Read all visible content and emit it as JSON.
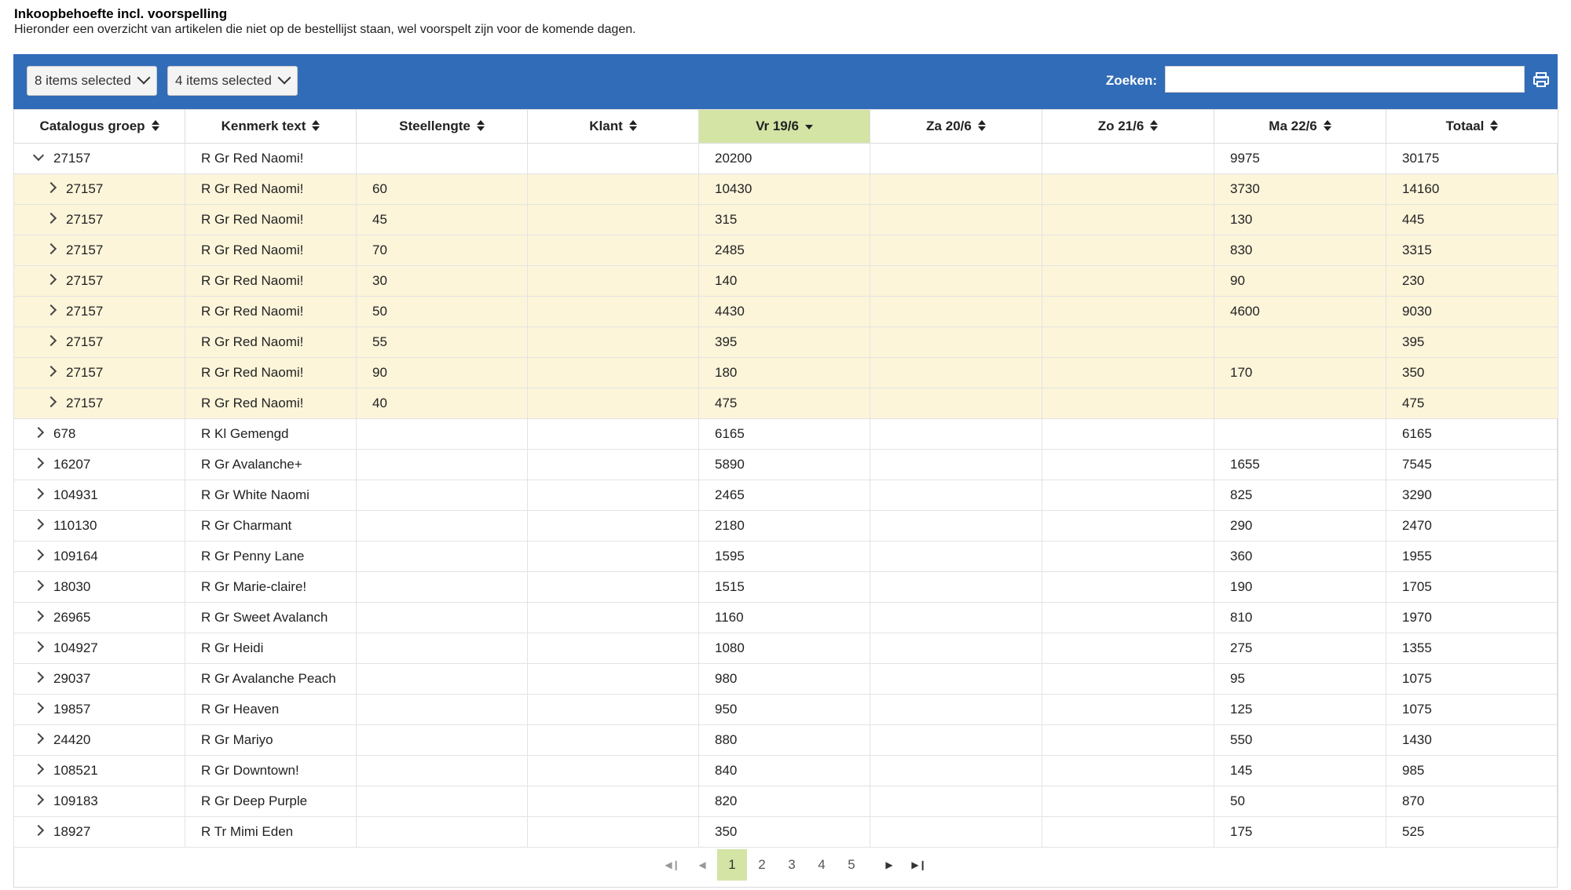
{
  "header": {
    "title": "Inkoopbehoefte incl. voorspelling",
    "subtitle": "Hieronder een overzicht van artikelen die niet op de bestellijst staan, wel voorspelt zijn voor de komende dagen."
  },
  "toolbar": {
    "dropdown1": "8 items selected",
    "dropdown2": "4 items selected",
    "search_label": "Zoeken:",
    "search_value": "",
    "accent_color": "#316cb8"
  },
  "columns": [
    "Catalogus groep",
    "Kenmerk text",
    "Steellengte",
    "Klant",
    "Vr 19/6",
    "Za 20/6",
    "Zo 21/6",
    "Ma 22/6",
    "Totaal"
  ],
  "sorted_column": "Vr 19/6",
  "rows": [
    {
      "level": 0,
      "open": true,
      "cells": [
        "27157",
        "R Gr Red Naomi!",
        "",
        "",
        "20200",
        "",
        "",
        "9975",
        "30175"
      ]
    },
    {
      "level": 1,
      "cells": [
        "27157",
        "R Gr Red Naomi!",
        "60",
        "",
        "10430",
        "",
        "",
        "3730",
        "14160"
      ]
    },
    {
      "level": 1,
      "cells": [
        "27157",
        "R Gr Red Naomi!",
        "45",
        "",
        "315",
        "",
        "",
        "130",
        "445"
      ]
    },
    {
      "level": 1,
      "cells": [
        "27157",
        "R Gr Red Naomi!",
        "70",
        "",
        "2485",
        "",
        "",
        "830",
        "3315"
      ]
    },
    {
      "level": 1,
      "cells": [
        "27157",
        "R Gr Red Naomi!",
        "30",
        "",
        "140",
        "",
        "",
        "90",
        "230"
      ]
    },
    {
      "level": 1,
      "cells": [
        "27157",
        "R Gr Red Naomi!",
        "50",
        "",
        "4430",
        "",
        "",
        "4600",
        "9030"
      ]
    },
    {
      "level": 1,
      "cells": [
        "27157",
        "R Gr Red Naomi!",
        "55",
        "",
        "395",
        "",
        "",
        "",
        "395"
      ]
    },
    {
      "level": 1,
      "cells": [
        "27157",
        "R Gr Red Naomi!",
        "90",
        "",
        "180",
        "",
        "",
        "170",
        "350"
      ]
    },
    {
      "level": 1,
      "cells": [
        "27157",
        "R Gr Red Naomi!",
        "40",
        "",
        "475",
        "",
        "",
        "",
        "475"
      ]
    },
    {
      "level": 0,
      "cells": [
        "678",
        "R Kl Gemengd",
        "",
        "",
        "6165",
        "",
        "",
        "",
        "6165"
      ]
    },
    {
      "level": 0,
      "cells": [
        "16207",
        "R Gr Avalanche+",
        "",
        "",
        "5890",
        "",
        "",
        "1655",
        "7545"
      ]
    },
    {
      "level": 0,
      "cells": [
        "104931",
        "R Gr White Naomi",
        "",
        "",
        "2465",
        "",
        "",
        "825",
        "3290"
      ]
    },
    {
      "level": 0,
      "cells": [
        "110130",
        "R Gr Charmant",
        "",
        "",
        "2180",
        "",
        "",
        "290",
        "2470"
      ]
    },
    {
      "level": 0,
      "cells": [
        "109164",
        "R Gr Penny Lane",
        "",
        "",
        "1595",
        "",
        "",
        "360",
        "1955"
      ]
    },
    {
      "level": 0,
      "cells": [
        "18030",
        "R Gr Marie-claire!",
        "",
        "",
        "1515",
        "",
        "",
        "190",
        "1705"
      ]
    },
    {
      "level": 0,
      "cells": [
        "26965",
        "R Gr Sweet Avalanch",
        "",
        "",
        "1160",
        "",
        "",
        "810",
        "1970"
      ]
    },
    {
      "level": 0,
      "cells": [
        "104927",
        "R Gr Heidi",
        "",
        "",
        "1080",
        "",
        "",
        "275",
        "1355"
      ]
    },
    {
      "level": 0,
      "cells": [
        "29037",
        "R Gr Avalanche Peach",
        "",
        "",
        "980",
        "",
        "",
        "95",
        "1075"
      ]
    },
    {
      "level": 0,
      "cells": [
        "19857",
        "R Gr Heaven",
        "",
        "",
        "950",
        "",
        "",
        "125",
        "1075"
      ]
    },
    {
      "level": 0,
      "cells": [
        "24420",
        "R Gr Mariyo",
        "",
        "",
        "880",
        "",
        "",
        "550",
        "1430"
      ]
    },
    {
      "level": 0,
      "cells": [
        "108521",
        "R Gr Downtown!",
        "",
        "",
        "840",
        "",
        "",
        "145",
        "985"
      ]
    },
    {
      "level": 0,
      "cells": [
        "109183",
        "R Gr Deep Purple",
        "",
        "",
        "820",
        "",
        "",
        "50",
        "870"
      ]
    },
    {
      "level": 0,
      "cells": [
        "18927",
        "R Tr Mimi Eden",
        "",
        "",
        "350",
        "",
        "",
        "175",
        "525"
      ]
    }
  ],
  "pager": {
    "pages": [
      "1",
      "2",
      "3",
      "4",
      "5"
    ],
    "current": "1"
  },
  "icons": {
    "expand": "chevron-right-icon",
    "collapse": "chevron-down-icon",
    "sort": "sort-icon",
    "print": "printer-icon"
  }
}
